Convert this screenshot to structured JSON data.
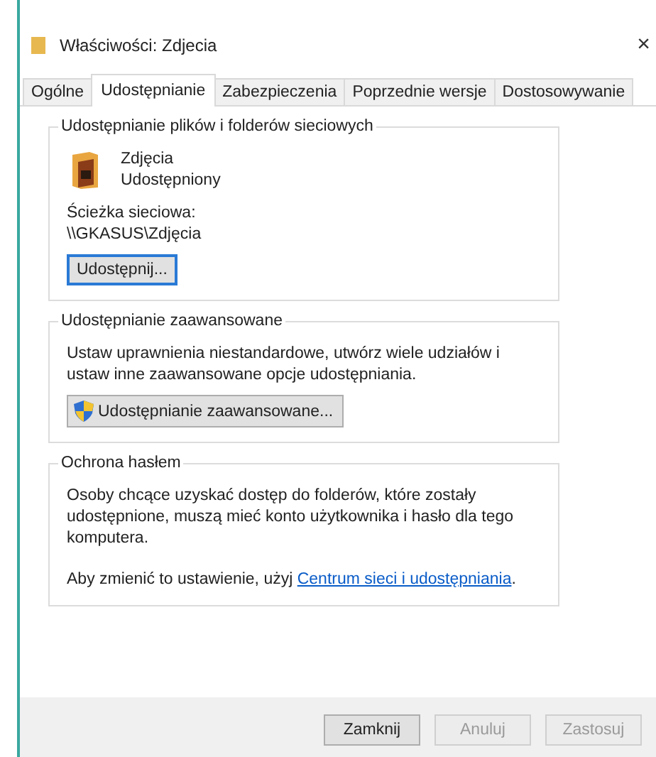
{
  "window": {
    "title": "Właściwości: Zdjecia",
    "close": "×"
  },
  "tabs": [
    {
      "label": "Ogólne",
      "selected": false
    },
    {
      "label": "Udostępnianie",
      "selected": true
    },
    {
      "label": "Zabezpieczenia",
      "selected": false
    },
    {
      "label": "Poprzednie wersje",
      "selected": false
    },
    {
      "label": "Dostosowywanie",
      "selected": false
    }
  ],
  "network_sharing": {
    "title": "Udostępnianie plików i folderów sieciowych",
    "folder_name": "Zdjęcia",
    "folder_status": "Udostępniony",
    "path_label": "Ścieżka sieciowa:",
    "path": "\\\\GKASUS\\Zdjęcia",
    "button": {
      "label": "Udostępnij...",
      "focused": true
    }
  },
  "advanced_sharing": {
    "title": "Udostępnianie zaawansowane",
    "description": "Ustaw uprawnienia niestandardowe, utwórz wiele udziałów i ustaw inne zaawansowane opcje udostępniania.",
    "button": "Udostępnianie zaawansowane..."
  },
  "password_protection": {
    "title": "Ochrona hasłem",
    "description": "Osoby chcące uzyskać dostęp do folderów, które zostały udostępnione, muszą mieć konto użytkownika i hasło dla tego komputera.",
    "note_before": "Aby zmienić to ustawienie, użyj ",
    "link": "Centrum sieci i udostępniania",
    "note_after": "."
  },
  "buttons": [
    {
      "label": "Zamknij",
      "disabled": false
    },
    {
      "label": "Anuluj",
      "disabled": true
    },
    {
      "label": "Zastosuj",
      "disabled": true
    }
  ]
}
